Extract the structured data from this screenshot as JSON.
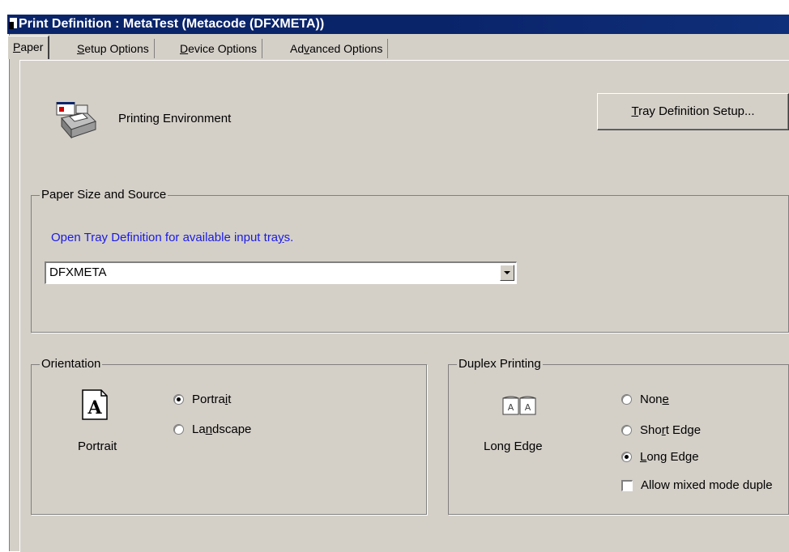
{
  "window": {
    "title": "Print Definition : MetaTest (Metacode (DFXMETA))"
  },
  "tabs": [
    {
      "label": "Paper",
      "mnemonic": "P",
      "rest": "aper",
      "active": true
    },
    {
      "label": "Setup Options",
      "mnemonic": "S",
      "rest": "etup Options"
    },
    {
      "label": "Device Options",
      "mnemonic": "D",
      "rest": "evice Options"
    },
    {
      "label": "Advanced Options",
      "pre": "Ad",
      "mnemonic": "v",
      "rest": "anced Options"
    }
  ],
  "environment": {
    "label": "Printing Environment",
    "icon": "printer-icon"
  },
  "tray_button": {
    "label": "Tray Definition Setup...",
    "mnemonic": "T",
    "rest": "ray Definition Setup..."
  },
  "paper_size": {
    "legend": "Paper Size and Source",
    "link_text": "Open Tray Definition for available input trays.",
    "link_pre": "Open Tray Definition for available input tra",
    "link_mnemonic": "y",
    "link_post": "s.",
    "selected": "DFXMETA"
  },
  "orientation": {
    "legend": "Orientation",
    "icon": "portrait-page-icon",
    "icon_caption": "Portrait",
    "options": [
      {
        "label": "Portrait",
        "pre": "Portra",
        "mnemonic": "i",
        "post": "t",
        "checked": true
      },
      {
        "label": "Landscape",
        "pre": "La",
        "mnemonic": "n",
        "post": "dscape",
        "checked": false
      }
    ]
  },
  "duplex": {
    "legend": "Duplex Printing",
    "icon": "duplex-long-edge-icon",
    "icon_caption": "Long Edge",
    "options": [
      {
        "label": "None",
        "pre": "Non",
        "mnemonic": "e",
        "post": "",
        "checked": false
      },
      {
        "label": "Short Edge",
        "pre": "Sho",
        "mnemonic": "r",
        "post": "t Edge",
        "checked": false
      },
      {
        "label": "Long Edge",
        "pre": "",
        "mnemonic": "L",
        "post": "ong Edge",
        "checked": true
      }
    ],
    "mixed_mode": {
      "label": "Allow mixed mode duple",
      "checked": false
    }
  }
}
